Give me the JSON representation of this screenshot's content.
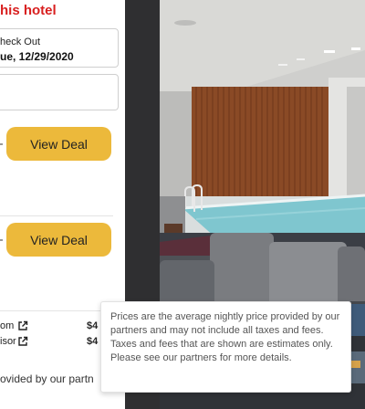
{
  "hotel": {
    "heading": "his hotel"
  },
  "checkout": {
    "label": "heck Out",
    "value": "ue, 12/29/2020"
  },
  "deals": [
    {
      "label": "View Deal"
    },
    {
      "label": "View Deal"
    }
  ],
  "partners": [
    {
      "name": "om",
      "price": "$4"
    },
    {
      "name": "isor",
      "price": "$4"
    }
  ],
  "disclaimer": {
    "text": "ovided by our partn"
  },
  "tooltip": {
    "text": "Prices are the average nightly price provided by our partners and may not include all taxes and fees. Taxes and fees that are shown are estimates only. Please see our partners for more details."
  },
  "icons": {
    "external": "external-link-icon"
  },
  "colors": {
    "heading": "#d81f1f",
    "deal_button": "#ecb93b",
    "panel_bg": "#ffffff",
    "page_bg": "#2f2f31"
  }
}
